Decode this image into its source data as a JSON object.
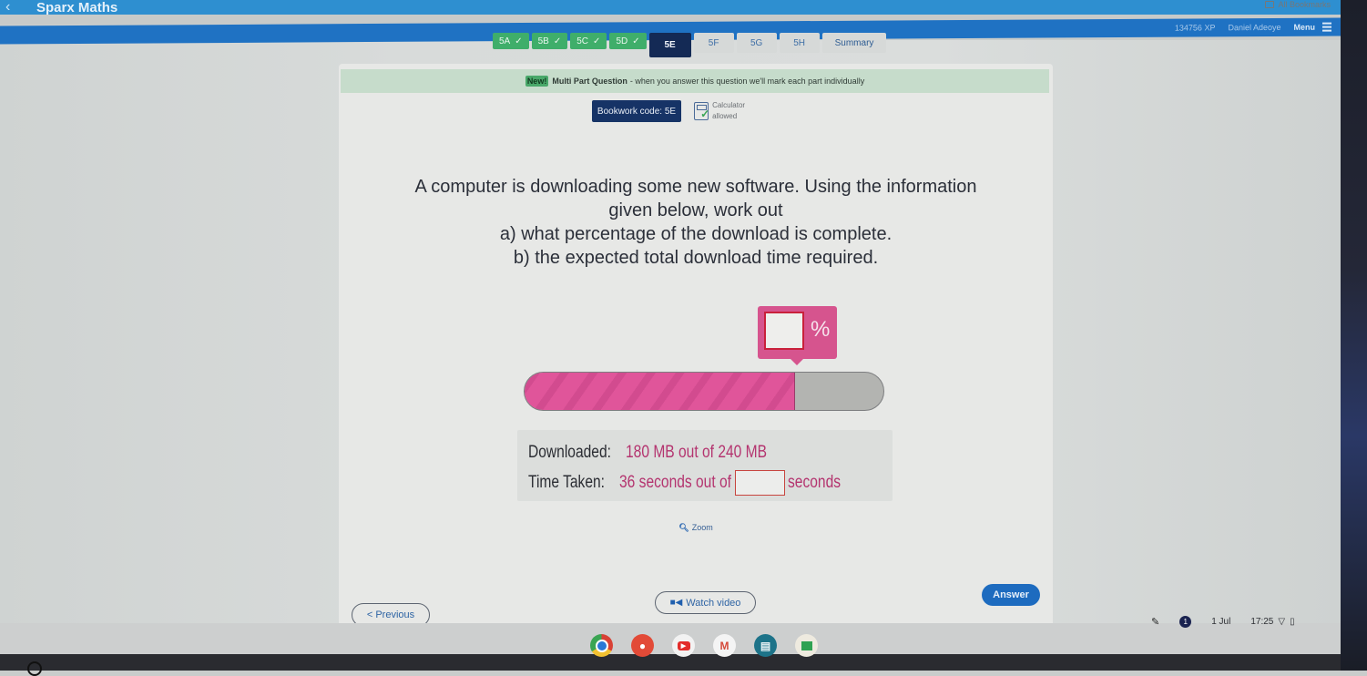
{
  "browser": {
    "bookmarks_label": "All Bookmarks"
  },
  "app": {
    "title": "Sparx Maths",
    "xp": "134756 XP",
    "username": "Daniel Adeoye",
    "menu_label": "Menu"
  },
  "tabs": [
    {
      "label": "5A",
      "state": "done"
    },
    {
      "label": "5B",
      "state": "done"
    },
    {
      "label": "5C",
      "state": "done"
    },
    {
      "label": "5D",
      "state": "done"
    },
    {
      "label": "5E",
      "state": "current"
    },
    {
      "label": "5F",
      "state": "todo"
    },
    {
      "label": "5G",
      "state": "todo"
    },
    {
      "label": "5H",
      "state": "todo"
    },
    {
      "label": "Summary",
      "state": "summary"
    }
  ],
  "notice": {
    "badge": "New!",
    "title": "Multi Part Question",
    "text": "- when you answer this question we'll mark each part individually"
  },
  "bookwork": {
    "code_label": "Bookwork code: 5E",
    "calculator_line1": "Calculator",
    "calculator_line2": "allowed"
  },
  "question": {
    "line1": "A computer is downloading some new software. Using the information",
    "line2": "given below, work out",
    "line3": "a) what percentage of the download is complete.",
    "line4": "b) the expected total download time required."
  },
  "percent_input": {
    "value": "",
    "unit": "%"
  },
  "progress": {
    "fraction": 0.75
  },
  "info": {
    "downloaded_label": "Downloaded:",
    "downloaded_value": "180 MB out of 240 MB",
    "time_label": "Time Taken:",
    "time_value": "36 seconds out of",
    "time_input_value": "",
    "time_unit": "seconds"
  },
  "zoom_label": "Zoom",
  "buttons": {
    "previous": "< Previous",
    "watch_video": "Watch video",
    "answer": "Answer"
  },
  "shelf": {
    "apps": [
      "chrome",
      "canvas",
      "youtube",
      "gmail",
      "slides",
      "classroom"
    ],
    "notification_count": "1",
    "date": "1 Jul",
    "time": "17:25"
  },
  "colors": {
    "header_blue": "#1f72c3",
    "done_green": "#3fae6a",
    "current_navy": "#142a55",
    "accent_pink": "#d6548e",
    "answer_blue": "#1d6bbf"
  }
}
